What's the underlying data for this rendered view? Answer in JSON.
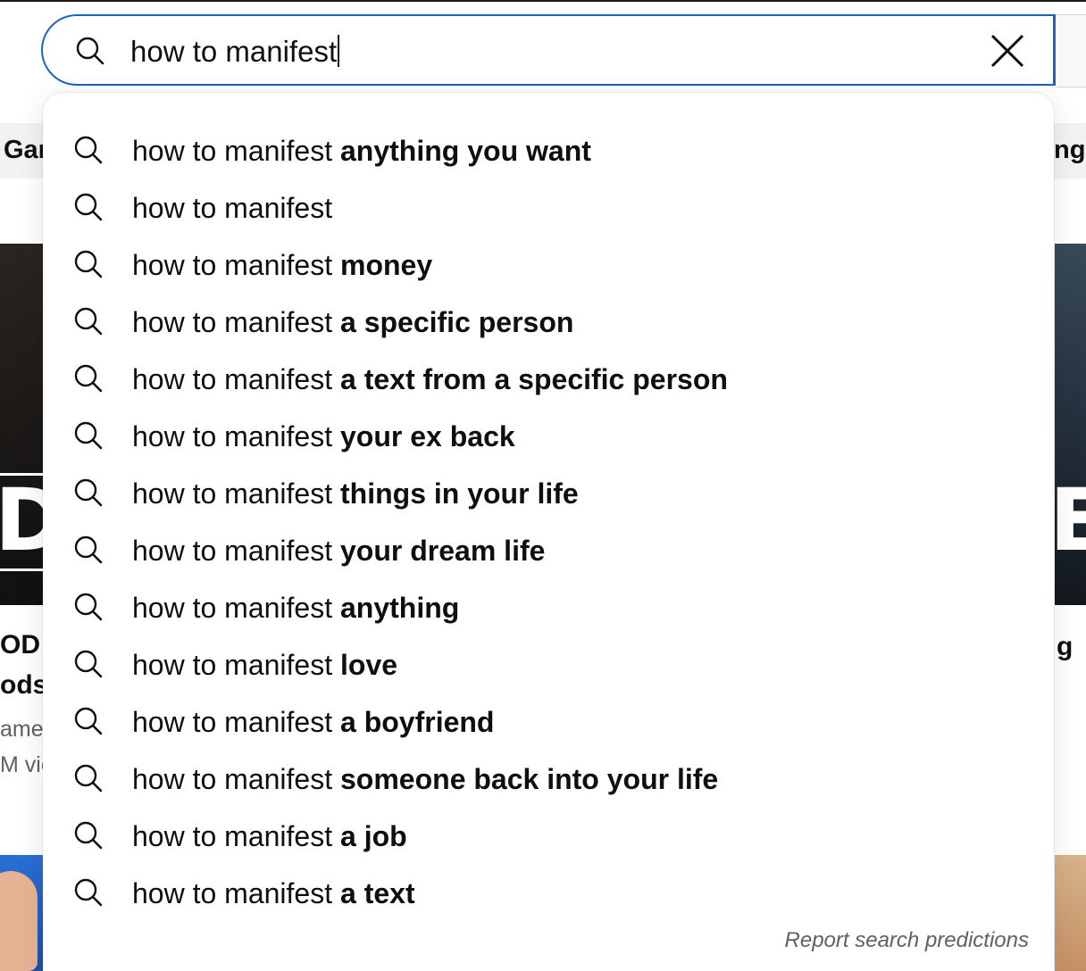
{
  "search": {
    "query": "how to manifest"
  },
  "background": {
    "chip_left_text": "Gar",
    "chip_right_text": "ng",
    "thumb_left_letter": "D",
    "thumb_right_letter": "E",
    "left_title_line1": "OD (",
    "left_title_line2": "ods",
    "left_meta_line1": "ame",
    "left_meta_line2": "M vie",
    "right_title_line1": "g"
  },
  "suggestions": [
    {
      "prefix": "how to manifest",
      "completion": " anything you want"
    },
    {
      "prefix": "how to manifest",
      "completion": ""
    },
    {
      "prefix": "how to manifest",
      "completion": " money"
    },
    {
      "prefix": "how to manifest",
      "completion": " a specific person"
    },
    {
      "prefix": "how to manifest",
      "completion": " a text from a specific person"
    },
    {
      "prefix": "how to manifest",
      "completion": " your ex back"
    },
    {
      "prefix": "how to manifest",
      "completion": " things in your life"
    },
    {
      "prefix": "how to manifest",
      "completion": " your dream life"
    },
    {
      "prefix": "how to manifest",
      "completion": " anything"
    },
    {
      "prefix": "how to manifest",
      "completion": " love"
    },
    {
      "prefix": "how to manifest",
      "completion": " a boyfriend"
    },
    {
      "prefix": "how to manifest",
      "completion": " someone back into your life"
    },
    {
      "prefix": "how to manifest",
      "completion": " a job"
    },
    {
      "prefix": "how to manifest",
      "completion": " a text"
    }
  ],
  "report_link": "Report search predictions",
  "icons": {
    "search": "search-icon",
    "clear": "close-icon"
  },
  "colors": {
    "focus_border": "#1c62b9",
    "text": "#0f0f0f",
    "muted": "#606060"
  }
}
